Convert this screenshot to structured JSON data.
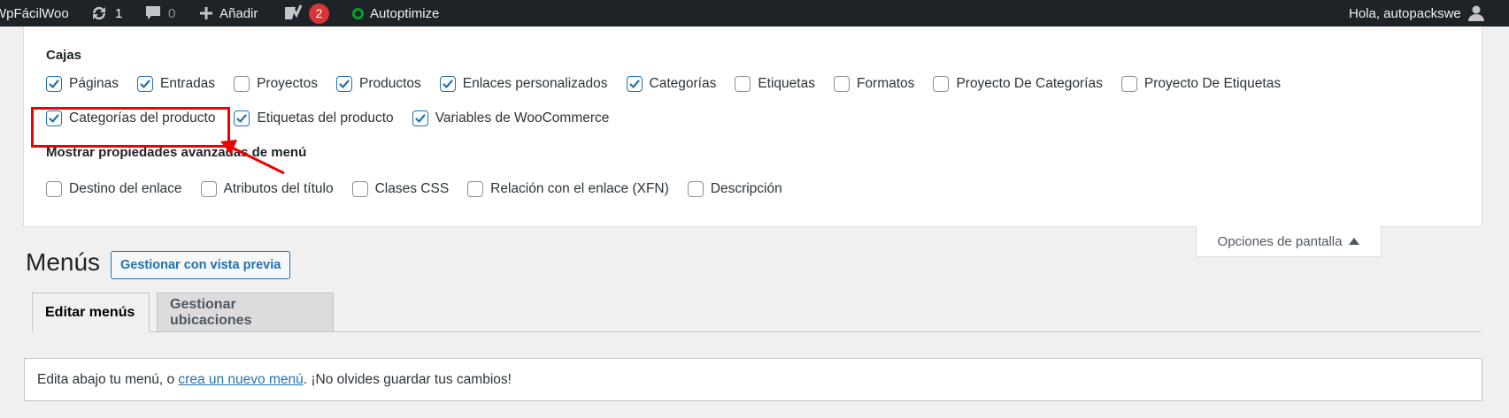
{
  "admin_bar": {
    "site_name": "WpFácilWoo",
    "updates_count": "1",
    "comments_count": "0",
    "new_label": "Añadir",
    "yoast_count": "2",
    "autoptimize_label": "Autoptimize",
    "greeting": "Hola, autopackswe"
  },
  "screen_options": {
    "boxes_legend": "Cajas",
    "boxes": [
      {
        "label": "Páginas",
        "checked": true
      },
      {
        "label": "Entradas",
        "checked": true
      },
      {
        "label": "Proyectos",
        "checked": false
      },
      {
        "label": "Productos",
        "checked": true
      },
      {
        "label": "Enlaces personalizados",
        "checked": true
      },
      {
        "label": "Categorías",
        "checked": true
      },
      {
        "label": "Etiquetas",
        "checked": false
      },
      {
        "label": "Formatos",
        "checked": false
      },
      {
        "label": "Proyecto De Categorías",
        "checked": false
      },
      {
        "label": "Proyecto De Etiquetas",
        "checked": false
      },
      {
        "label": "Categorías del producto",
        "checked": true
      },
      {
        "label": "Etiquetas del producto",
        "checked": true
      },
      {
        "label": "Variables de WooCommerce",
        "checked": true
      }
    ],
    "advanced_legend": "Mostrar propiedades avanzadas de menú",
    "advanced": [
      {
        "label": "Destino del enlace",
        "checked": false
      },
      {
        "label": "Atributos del título",
        "checked": false
      },
      {
        "label": "Clases CSS",
        "checked": false
      },
      {
        "label": "Relación con el enlace (XFN)",
        "checked": false
      },
      {
        "label": "Descripción",
        "checked": false
      }
    ],
    "tab_label": "Opciones de pantalla"
  },
  "page": {
    "title": "Menús",
    "preview_button": "Gestionar con vista previa",
    "tabs": [
      {
        "label": "Editar menús",
        "active": true
      },
      {
        "label": "Gestionar ubicaciones",
        "active": false
      }
    ],
    "notice": {
      "prefix": "Edita abajo tu menú, o ",
      "link": "crea un nuevo menú",
      "suffix": ". ¡No olvides guardar tus cambios!"
    }
  },
  "colors": {
    "accent": "#2271b1",
    "annotation": "#e00000"
  }
}
